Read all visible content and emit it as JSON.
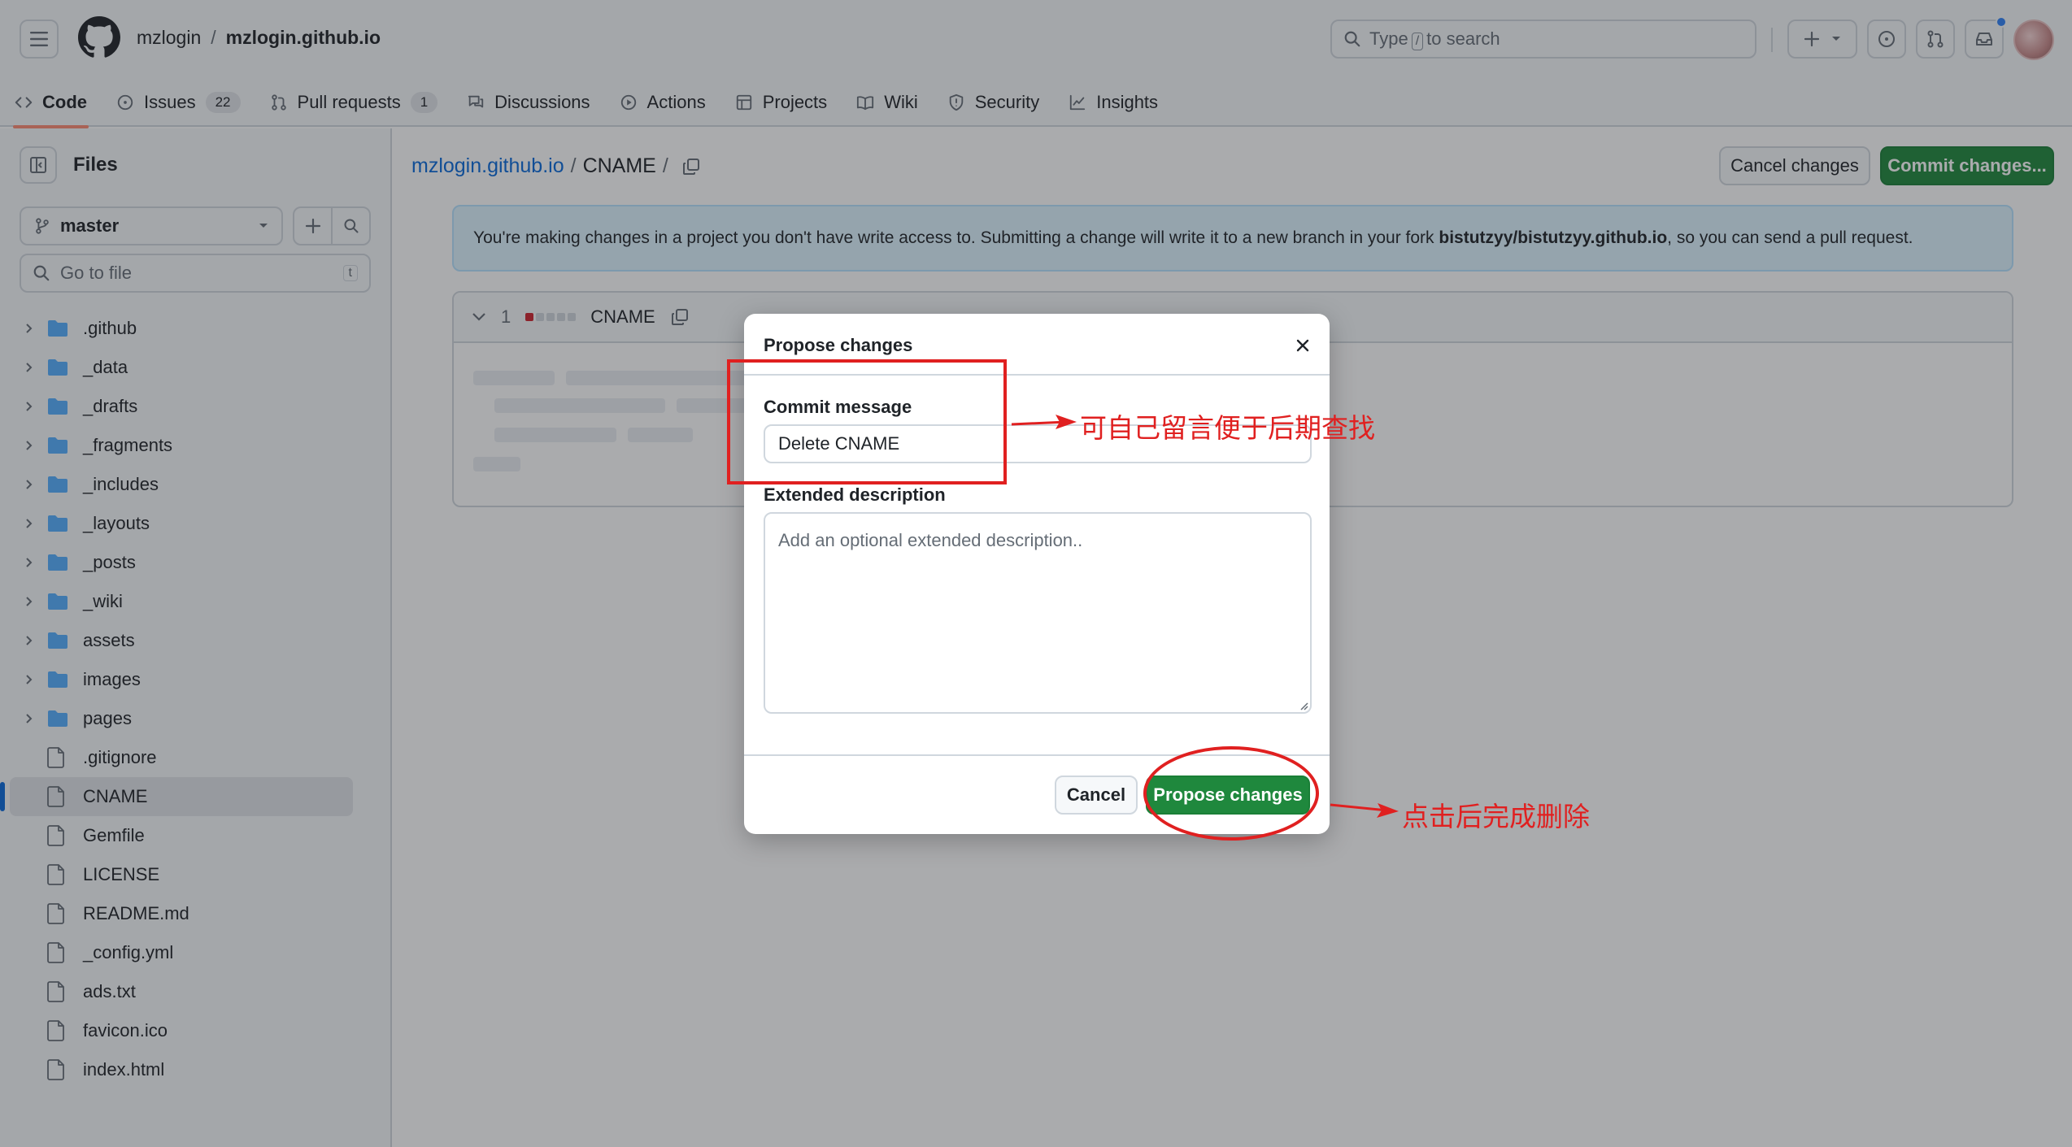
{
  "header": {
    "owner": "mzlogin",
    "separator": "/",
    "repo": "mzlogin.github.io",
    "search_before": "Type",
    "search_key": "/",
    "search_after": "to search"
  },
  "tabs": [
    {
      "label": "Code",
      "count": ""
    },
    {
      "label": "Issues",
      "count": "22"
    },
    {
      "label": "Pull requests",
      "count": "1"
    },
    {
      "label": "Discussions",
      "count": ""
    },
    {
      "label": "Actions",
      "count": ""
    },
    {
      "label": "Projects",
      "count": ""
    },
    {
      "label": "Wiki",
      "count": ""
    },
    {
      "label": "Security",
      "count": ""
    },
    {
      "label": "Insights",
      "count": ""
    }
  ],
  "sidebar": {
    "title": "Files",
    "branch": "master",
    "goto_placeholder": "Go to file",
    "goto_key": "t",
    "folders": [
      ".github",
      "_data",
      "_drafts",
      "_fragments",
      "_includes",
      "_layouts",
      "_posts",
      "_wiki",
      "assets",
      "images",
      "pages"
    ],
    "files": [
      ".gitignore",
      "CNAME",
      "Gemfile",
      "LICENSE",
      "README.md",
      "_config.yml",
      "ads.txt",
      "favicon.ico",
      "index.html"
    ],
    "selected": "CNAME"
  },
  "main": {
    "path_repo": "mzlogin.github.io",
    "path_sep": "/",
    "path_file": "CNAME",
    "path_trail": "/",
    "cancel_label": "Cancel changes",
    "commit_label": "Commit changes...",
    "banner_pre": "You're making changes in a project you don't have write access to. Submitting a change will write it to a new branch in your fork ",
    "banner_fork": "bistutzyy/bistutzyy.github.io",
    "banner_post": ", so you can send a pull request.",
    "file_lines": "1",
    "file_name": "CNAME"
  },
  "dialog": {
    "title": "Propose changes",
    "commit_label": "Commit message",
    "commit_value": "Delete CNAME",
    "desc_label": "Extended description",
    "desc_placeholder": "Add an optional extended description..",
    "cancel": "Cancel",
    "submit": "Propose changes"
  },
  "annotations": {
    "note_message": "可自己留言便于后期查找",
    "note_submit": "点击后完成删除",
    "color": "#e02020"
  },
  "colors": {
    "primary": "#1f883d",
    "link": "#0969da",
    "banner_bg": "#ddf4ff",
    "tab_underline": "#fd8c73"
  }
}
